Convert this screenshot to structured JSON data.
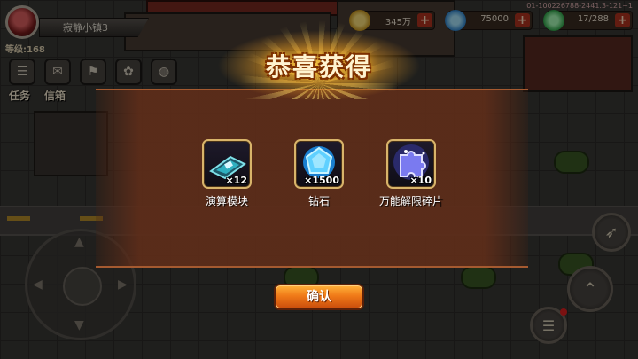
{
  "hud": {
    "player_name": "寂静小镇3",
    "level": "等级:168",
    "menu": [
      {
        "label": "任务",
        "icon": "task-icon"
      },
      {
        "label": "信箱",
        "icon": "mailbox-icon"
      },
      {
        "label": "",
        "icon": "guild-icon"
      },
      {
        "label": "",
        "icon": "settings-icon"
      },
      {
        "label": "",
        "icon": "globe-icon"
      }
    ]
  },
  "currencies": {
    "gold": {
      "value": "345万",
      "icon": "gold-coin-icon",
      "color": "#e0b030"
    },
    "gems": {
      "value": "75000",
      "icon": "diamond-icon",
      "color": "#39a6e8"
    },
    "stamina": {
      "value": "17/288",
      "icon": "energy-icon",
      "color": "#3cc060"
    }
  },
  "build_id": "01-100226788-2441.3-121~1",
  "modal": {
    "title": "恭喜获得",
    "rewards": [
      {
        "name": "演算模块",
        "qty": "×12",
        "icon": "compute-module-icon",
        "rarity_color": "#d8b46a"
      },
      {
        "name": "钻石",
        "qty": "×1500",
        "icon": "diamond-icon",
        "rarity_color": "#d8b46a"
      },
      {
        "name": "万能解限碎片",
        "qty": "×10",
        "icon": "puzzle-fragment-icon",
        "rarity_color": "#d8b46a"
      }
    ],
    "confirm_label": "确认"
  }
}
